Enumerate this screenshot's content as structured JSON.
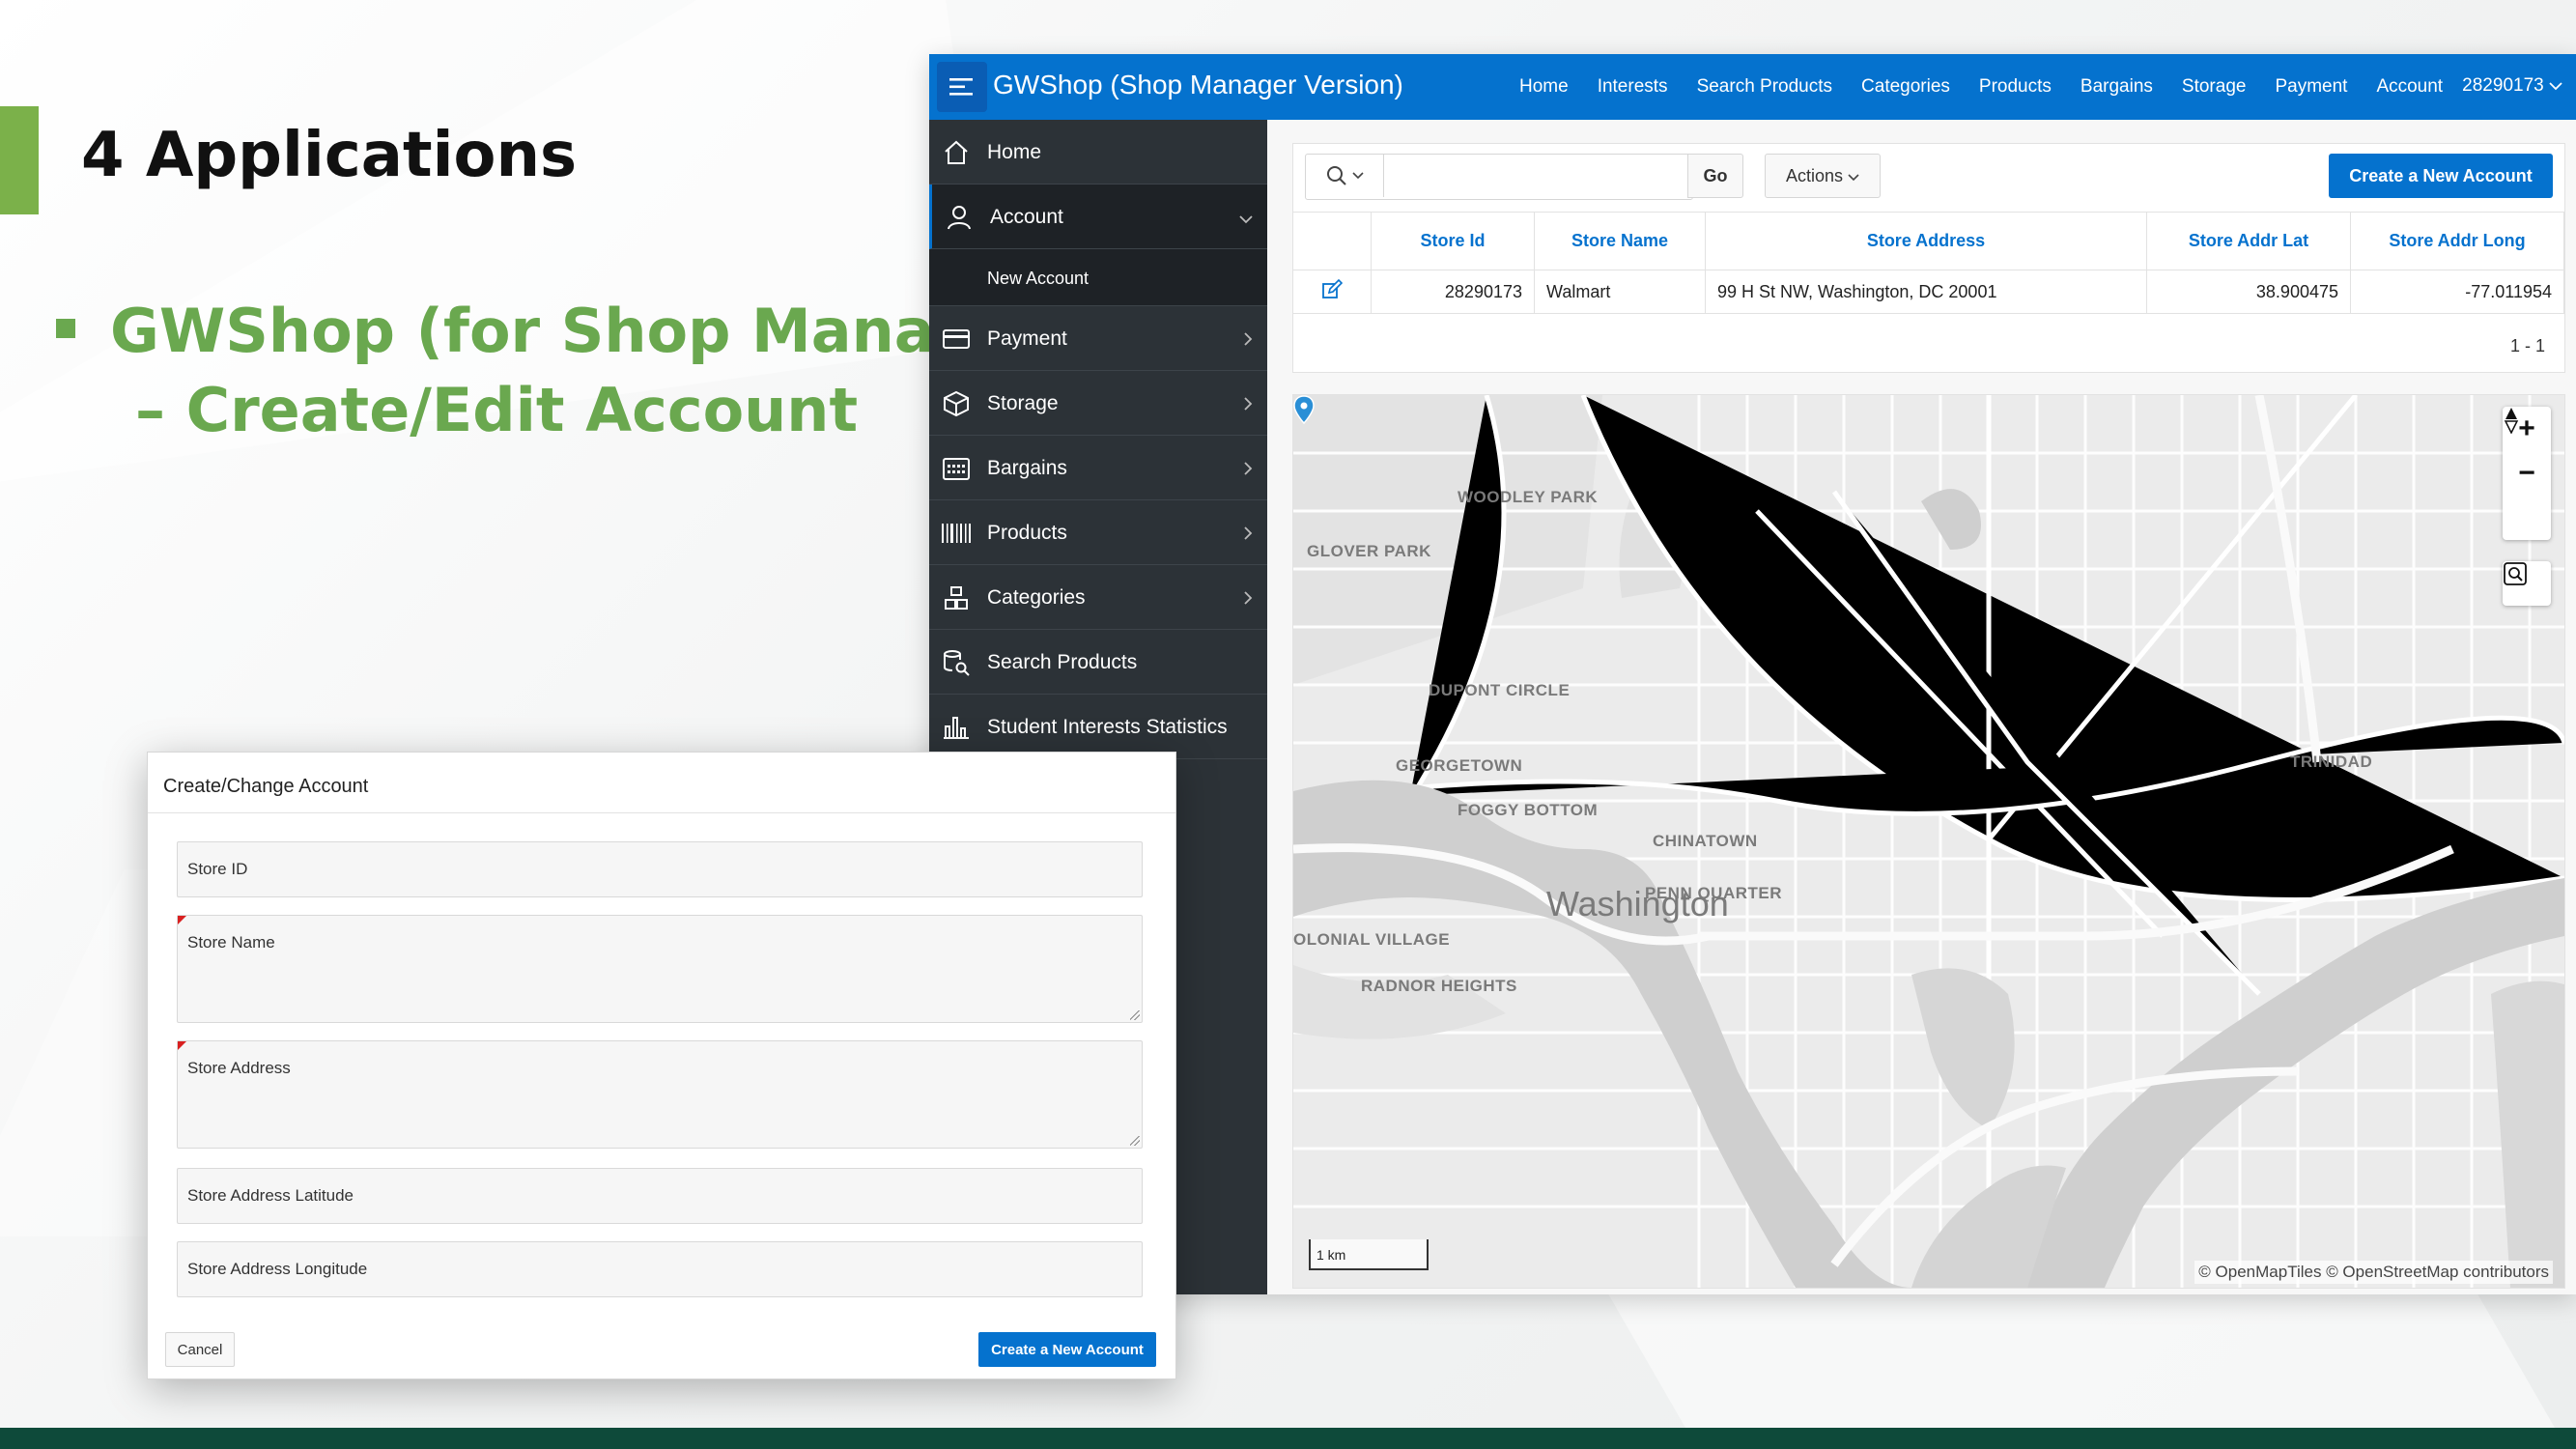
{
  "slide": {
    "title": "4 Applications",
    "bullet_line1": "GWShop (for Shop Manager)",
    "bullet_line2": "– Create/Edit Account",
    "accent_color": "#6aa84f"
  },
  "app": {
    "title": "GWShop (Shop Manager Version)",
    "topnav": [
      "Home",
      "Interests",
      "Search Products",
      "Categories",
      "Products",
      "Bargains",
      "Storage",
      "Payment",
      "Account"
    ],
    "user": "28290173",
    "brand_color": "#0572ce"
  },
  "sidebar": {
    "items": [
      {
        "label": "Home",
        "icon": "home-icon"
      },
      {
        "label": "Account",
        "icon": "user-icon"
      },
      {
        "label": "Payment",
        "icon": "credit-card-icon"
      },
      {
        "label": "Storage",
        "icon": "box-icon"
      },
      {
        "label": "Bargains",
        "icon": "calendar-icon"
      },
      {
        "label": "Products",
        "icon": "barcode-icon"
      },
      {
        "label": "Categories",
        "icon": "categories-icon"
      },
      {
        "label": "Search Products",
        "icon": "search-database-icon"
      },
      {
        "label": "Student Interests Statistics",
        "icon": "bar-chart-icon"
      }
    ],
    "subitem": "New Account"
  },
  "report": {
    "search_placeholder": "",
    "go_label": "Go",
    "actions_label": "Actions",
    "create_label": "Create a New Account",
    "columns": [
      "Store Id",
      "Store Name",
      "Store Address",
      "Store Addr Lat",
      "Store Addr Long"
    ],
    "rows": [
      {
        "store_id": "28290173",
        "store_name": "Walmart",
        "store_address": "99 H St NW, Washington, DC 20001",
        "lat": "38.900475",
        "long": "-77.011954"
      }
    ],
    "pagination": "1 - 1"
  },
  "map": {
    "labels": {
      "woodley": "WOODLEY PARK",
      "glover": "GLOVER PARK",
      "dupont": "DUPONT CIRCLE",
      "georgetown": "GEORGETOWN",
      "foggy": "FOGGY BOTTOM",
      "chinatown": "CHINATOWN",
      "penn": "PENN QUARTER",
      "washington": "Washington",
      "colonial": "OLONIAL VILLAGE",
      "radnor": "RADNOR HEIGHTS",
      "trinidad": "TRINIDAD"
    },
    "zoom_in": "+",
    "zoom_out": "−",
    "scale": "1 km",
    "attribution": "© OpenMapTiles  © OpenStreetMap contributors"
  },
  "dialog": {
    "title": "Create/Change Account",
    "fields": [
      "Store ID",
      "Store Name",
      "Store Address",
      "Store Address Latitude",
      "Store Address Longitude"
    ],
    "cancel_label": "Cancel",
    "create_label": "Create a New Account"
  }
}
